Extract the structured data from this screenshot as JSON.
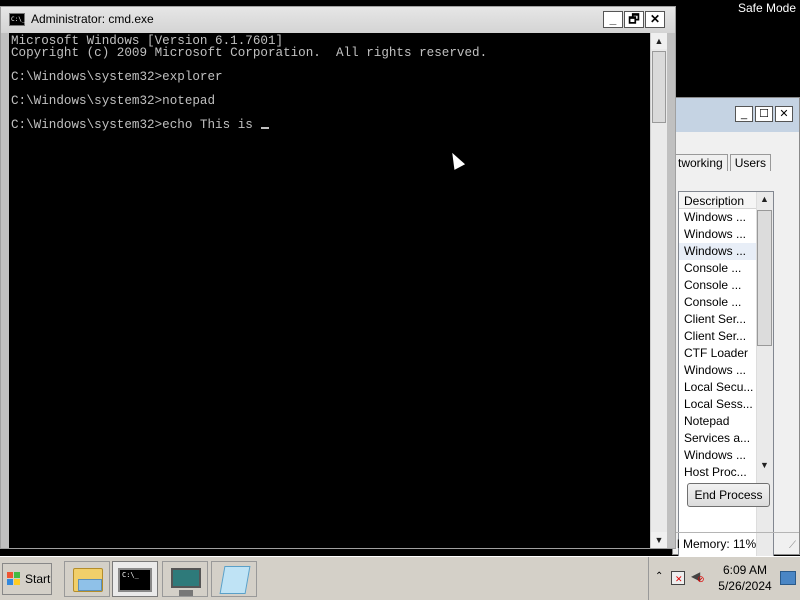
{
  "desktop": {
    "mode_label": "Safe Mode"
  },
  "cmd": {
    "title": "Administrator: cmd.exe",
    "icon_text": "C:\\_",
    "buttons": {
      "minimize": "_",
      "restore": "🗗",
      "close": "✕"
    },
    "lines": [
      "Microsoft Windows [Version 6.1.7601]",
      "Copyright (c) 2009 Microsoft Corporation.  All rights reserved.",
      "",
      "C:\\Windows\\system32>explorer",
      "",
      "C:\\Windows\\system32>notepad",
      "",
      "C:\\Windows\\system32>echo This is "
    ]
  },
  "taskmgr": {
    "buttons": {
      "minimize": "_",
      "maximize": "☐",
      "close": "✕"
    },
    "tabs": [
      "tworking",
      "Users"
    ],
    "column_header": "Description",
    "rows": [
      "Windows ...",
      "Windows ...",
      "Windows ...",
      "Console ...",
      "Console ...",
      "Console ...",
      "Client Ser...",
      "Client Ser...",
      "CTF Loader",
      "Windows ...",
      "Local Secu...",
      "Local Sess...",
      "Notepad",
      "Services a...",
      "Windows ...",
      "Host Proc..."
    ],
    "selected_row": 2,
    "end_process_label": "End Process",
    "status": "l Memory: 11%"
  },
  "taskbar": {
    "start_label": "Start",
    "items": [
      "Windows Explorer",
      "cmd.exe",
      "Task Manager",
      "Notepad"
    ],
    "tray": {
      "up_arrow": "⌃",
      "time": "6:09 AM",
      "date": "5/26/2024"
    }
  },
  "colors": {
    "console_bg": "#000000",
    "console_fg": "#c0c0c0",
    "titlebar": "#d4d4d4",
    "taskbar": "#d4d0c8"
  }
}
